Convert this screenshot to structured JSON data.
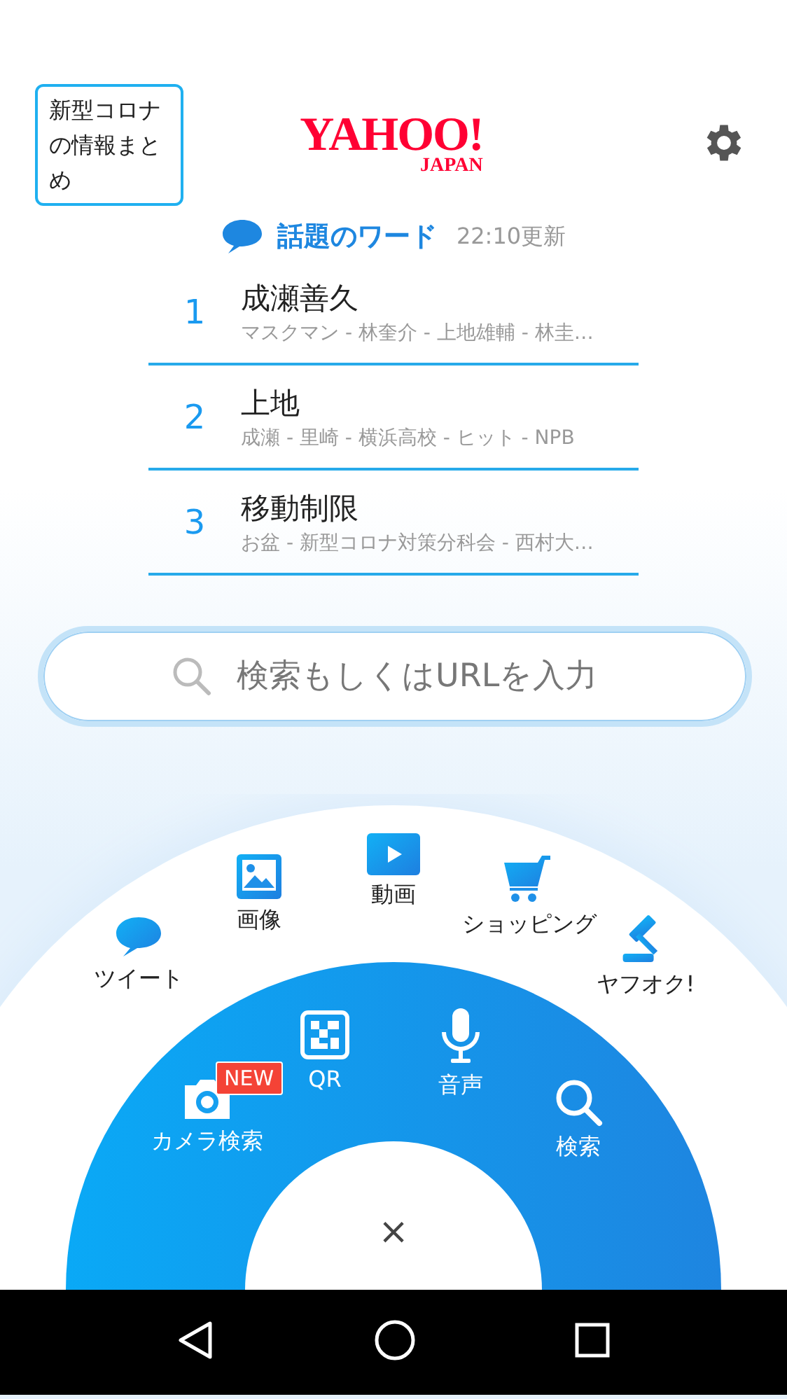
{
  "header": {
    "covid_link": "新型コロナの情報まとめ",
    "logo": {
      "main": "YAHOO!",
      "sub": "JAPAN"
    }
  },
  "trending": {
    "title": "話題のワード",
    "updated": "22:10更新",
    "items": [
      {
        "rank": "1",
        "word": "成瀬善久",
        "related": "マスクマン - 林奎介 - 上地雄輔 - 林圭…"
      },
      {
        "rank": "2",
        "word": "上地",
        "related": "成瀬 - 里崎 - 横浜高校 - ヒット - NPB"
      },
      {
        "rank": "3",
        "word": "移動制限",
        "related": "お盆 - 新型コロナ対策分科会 - 西村大…"
      }
    ]
  },
  "search": {
    "placeholder": "検索もしくはURLを入力"
  },
  "wheel": {
    "outer_items": [
      {
        "kind": "tweet",
        "label": "ツイート"
      },
      {
        "kind": "image",
        "label": "画像"
      },
      {
        "kind": "video",
        "label": "動画"
      },
      {
        "kind": "shopping",
        "label": "ショッピング"
      },
      {
        "kind": "auction",
        "label": "ヤフオク!"
      }
    ],
    "inner_items": [
      {
        "kind": "camera",
        "label": "カメラ検索",
        "badge": "NEW"
      },
      {
        "kind": "qr",
        "label": "QR"
      },
      {
        "kind": "voice",
        "label": "音声"
      },
      {
        "kind": "search",
        "label": "検索"
      }
    ],
    "close": "×"
  }
}
